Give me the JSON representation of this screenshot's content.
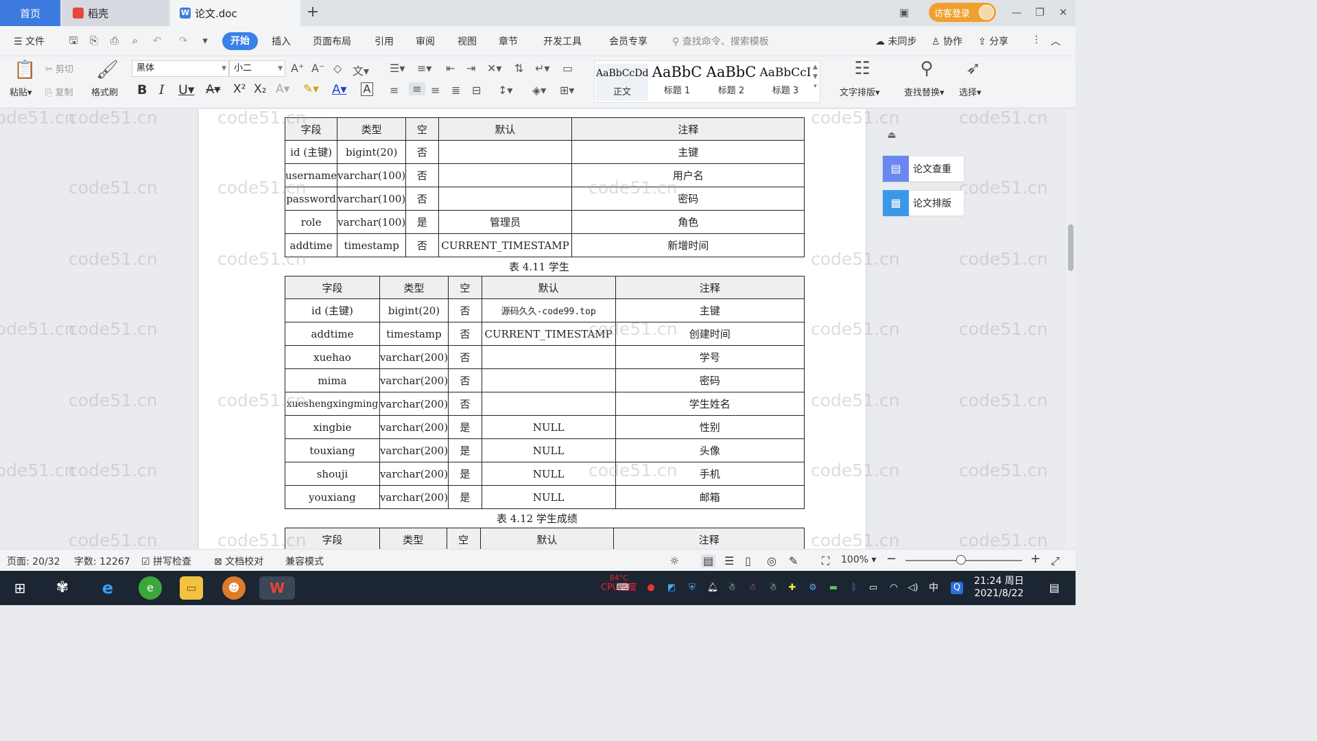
{
  "tabs": [
    {
      "label": "首页"
    },
    {
      "label": "稻壳"
    },
    {
      "label": "论文.doc"
    }
  ],
  "titlebar": {
    "login_label": "访客登录"
  },
  "menu": {
    "file_label": "文件",
    "items": [
      "开始",
      "插入",
      "页面布局",
      "引用",
      "审阅",
      "视图",
      "章节",
      "开发工具",
      "会员专享"
    ],
    "search_placeholder": "查找命令、搜索模板",
    "sync_label": "未同步",
    "collab_label": "协作",
    "share_label": "分享"
  },
  "ribbon": {
    "paste_label": "粘贴",
    "cut_label": "剪切",
    "copy_label": "复制",
    "format_painter_label": "格式刷",
    "font_name": "黑体",
    "font_size": "小二",
    "styles": [
      {
        "sample": "AaBbCcDd",
        "name": "正文"
      },
      {
        "sample": "AaBbC",
        "name": "标题 1"
      },
      {
        "sample": "AaBbC",
        "name": "标题 2"
      },
      {
        "sample": "AaBbCcI",
        "name": "标题 3"
      }
    ],
    "text_layout_label": "文字排版",
    "find_replace_label": "查找替换",
    "select_label": "选择"
  },
  "side_panel": {
    "check_label": "论文查重",
    "layout_label": "论文排版"
  },
  "watermark_text": "code51.cn",
  "document": {
    "table1": {
      "headers": [
        "字段",
        "类型",
        "空",
        "默认",
        "注释"
      ],
      "rows": [
        [
          "id (主键)",
          "bigint(20)",
          "否",
          "",
          "主键"
        ],
        [
          "username",
          "varchar(100)",
          "否",
          "",
          "用户名"
        ],
        [
          "password",
          "varchar(100)",
          "否",
          "",
          "密码"
        ],
        [
          "role",
          "varchar(100)",
          "是",
          "管理员",
          "角色"
        ],
        [
          "addtime",
          "timestamp",
          "否",
          "CURRENT_TIMESTAMP",
          "新增时间"
        ]
      ]
    },
    "caption2": "表 4.11 学生",
    "table2": {
      "headers": [
        "字段",
        "类型",
        "空",
        "默认",
        "注释"
      ],
      "rows": [
        [
          "id (主键)",
          "bigint(20)",
          "否",
          "源码久久-code99.top",
          "主键"
        ],
        [
          "addtime",
          "timestamp",
          "否",
          "CURRENT_TIMESTAMP",
          "创建时间"
        ],
        [
          "xuehao",
          "varchar(200)",
          "否",
          "",
          "学号"
        ],
        [
          "mima",
          "varchar(200)",
          "否",
          "",
          "密码"
        ],
        [
          "xueshengxingming",
          "varchar(200)",
          "否",
          "",
          "学生姓名"
        ],
        [
          "xingbie",
          "varchar(200)",
          "是",
          "NULL",
          "性别"
        ],
        [
          "touxiang",
          "varchar(200)",
          "是",
          "NULL",
          "头像"
        ],
        [
          "shouji",
          "varchar(200)",
          "是",
          "NULL",
          "手机"
        ],
        [
          "youxiang",
          "varchar(200)",
          "是",
          "NULL",
          "邮箱"
        ]
      ]
    },
    "caption3": "表 4.12 学生成绩",
    "table3": {
      "headers": [
        "字段",
        "类型",
        "空",
        "默认",
        "注释"
      ]
    }
  },
  "statusbar": {
    "page": "页面: 20/32",
    "words": "字数: 12267",
    "spell_check": "拼写检查",
    "doc_check": "文档校对",
    "compat_mode": "兼容模式",
    "zoom": "100%"
  },
  "taskbar": {
    "cpu_temp": "84°C",
    "cpu_label": "CPU温度",
    "ime": "中",
    "time": "21:24 周日",
    "date": "2021/8/22"
  }
}
